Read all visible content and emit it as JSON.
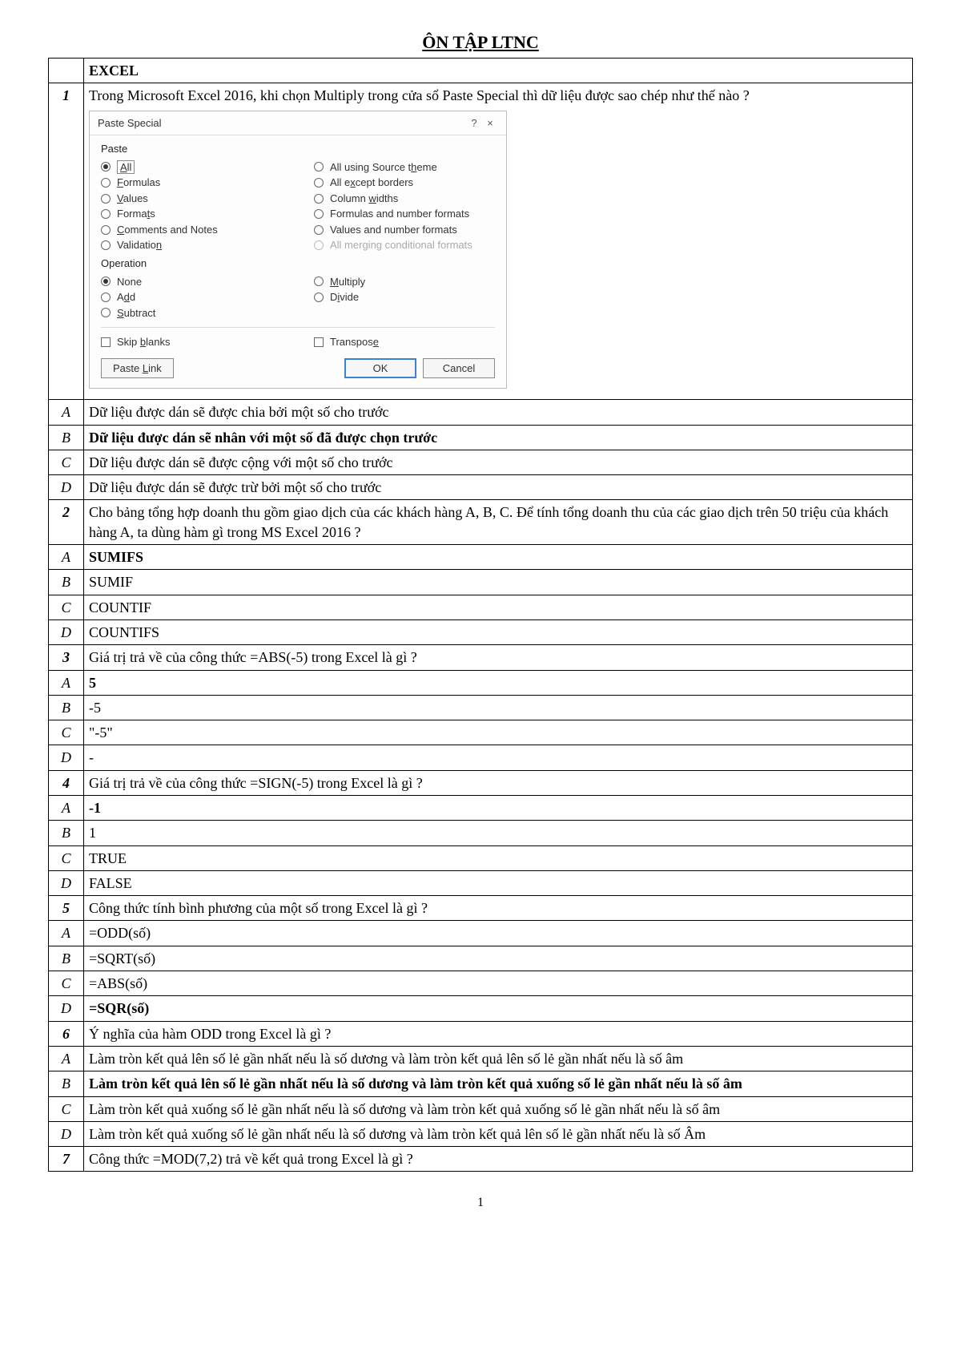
{
  "title": "ÔN TẬP LTNC",
  "pageno": "1",
  "section_head": "EXCEL",
  "dialog": {
    "title": "Paste Special",
    "help": "?",
    "close": "×",
    "paste_label": "Paste",
    "operation_label": "Operation",
    "paste_left": [
      "All",
      "Formulas",
      "Values",
      "Formats",
      "Comments and Notes",
      "Validation"
    ],
    "paste_left_ul": [
      "A",
      "F",
      "V",
      "t",
      "C",
      "n"
    ],
    "paste_right": [
      "All using Source theme",
      "All except borders",
      "Column widths",
      "Formulas and number formats",
      "Values and number formats",
      "All merging conditional formats"
    ],
    "paste_right_ul": [
      "h",
      "x",
      "w",
      "",
      "",
      ""
    ],
    "op_left": [
      "None",
      "Add",
      "Subtract"
    ],
    "op_left_ul": [
      "O",
      "d",
      "S"
    ],
    "op_right": [
      "Multiply",
      "Divide"
    ],
    "op_right_ul": [
      "M",
      "i"
    ],
    "skip_blanks": "Skip blanks",
    "skip_ul": "b",
    "transpose": "Transpose",
    "transpose_ul": "e",
    "paste_link": "Paste Link",
    "paste_link_ul": "L",
    "ok": "OK",
    "cancel": "Cancel"
  },
  "rows": [
    {
      "lbl": "1",
      "num": true,
      "text": "Trong Microsoft Excel 2016, khi chọn Multiply trong cửa sổ Paste Special thì dữ liệu được sao chép như thế nào ?",
      "dialog": true
    },
    {
      "lbl": "A",
      "text": "Dữ liệu được dán sẽ được chia bởi một số cho trước"
    },
    {
      "lbl": "B",
      "bold": true,
      "text": "Dữ liệu được dán sẽ nhân với một số đã được chọn trước"
    },
    {
      "lbl": "C",
      "text": "Dữ liệu được dán sẽ được cộng với một số cho trước"
    },
    {
      "lbl": "D",
      "text": "Dữ liệu được dán sẽ được trừ bởi một số cho trước"
    },
    {
      "lbl": "2",
      "num": true,
      "text": "Cho bảng tổng hợp doanh thu gồm giao dịch của các khách hàng A, B, C. Để tính tổng doanh thu của các giao dịch trên 50 triệu của khách hàng A, ta dùng hàm gì trong MS Excel 2016 ?"
    },
    {
      "lbl": "A",
      "bold": true,
      "text": "SUMIFS"
    },
    {
      "lbl": "B",
      "text": "SUMIF"
    },
    {
      "lbl": "C",
      "text": "COUNTIF"
    },
    {
      "lbl": "D",
      "text": "COUNTIFS"
    },
    {
      "lbl": "3",
      "num": true,
      "text": "Giá trị trả về của công thức =ABS(-5) trong Excel là gì ?"
    },
    {
      "lbl": "A",
      "bold": true,
      "text": "5"
    },
    {
      "lbl": "B",
      "text": "-5"
    },
    {
      "lbl": "C",
      "text": "\"-5\""
    },
    {
      "lbl": "D",
      "text": "-"
    },
    {
      "lbl": "4",
      "num": true,
      "text": "Giá trị trả về của công thức =SIGN(-5) trong Excel là gì ?"
    },
    {
      "lbl": "A",
      "bold": true,
      "text": "-1"
    },
    {
      "lbl": "B",
      "text": "1"
    },
    {
      "lbl": "C",
      "text": "TRUE"
    },
    {
      "lbl": "D",
      "text": "FALSE"
    },
    {
      "lbl": "5",
      "num": true,
      "text": "Công thức tính bình phương của một số trong Excel là gì ?"
    },
    {
      "lbl": "A",
      "text": "=ODD(số)"
    },
    {
      "lbl": "B",
      "text": "=SQRT(số)"
    },
    {
      "lbl": "C",
      "text": "=ABS(số)"
    },
    {
      "lbl": "D",
      "bold": true,
      "text": "=SQR(số)"
    },
    {
      "lbl": "6",
      "num": true,
      "text": "Ý nghĩa của hàm ODD trong Excel là gì ?"
    },
    {
      "lbl": "A",
      "text": "Làm tròn kết quả lên số lẻ gần nhất nếu là số dương và làm tròn kết quả lên số lẻ gần nhất nếu là số âm"
    },
    {
      "lbl": "B",
      "bold": true,
      "text": "Làm tròn kết quả lên số lẻ gần nhất nếu là số dương và làm tròn kết quả xuống số lẻ gần nhất nếu là số âm"
    },
    {
      "lbl": "C",
      "text": "Làm tròn kết quả xuống số lẻ gần nhất nếu là số dương và làm tròn kết quả xuống số lẻ gần nhất nếu là số âm"
    },
    {
      "lbl": "D",
      "text": "Làm tròn kết quả xuống số lẻ gần nhất nếu là số dương và làm tròn kết quả lên số lẻ gần nhất nếu là số Âm"
    },
    {
      "lbl": "7",
      "num": true,
      "text": "Công thức =MOD(7,2) trả về kết quả trong Excel là gì ?"
    }
  ]
}
